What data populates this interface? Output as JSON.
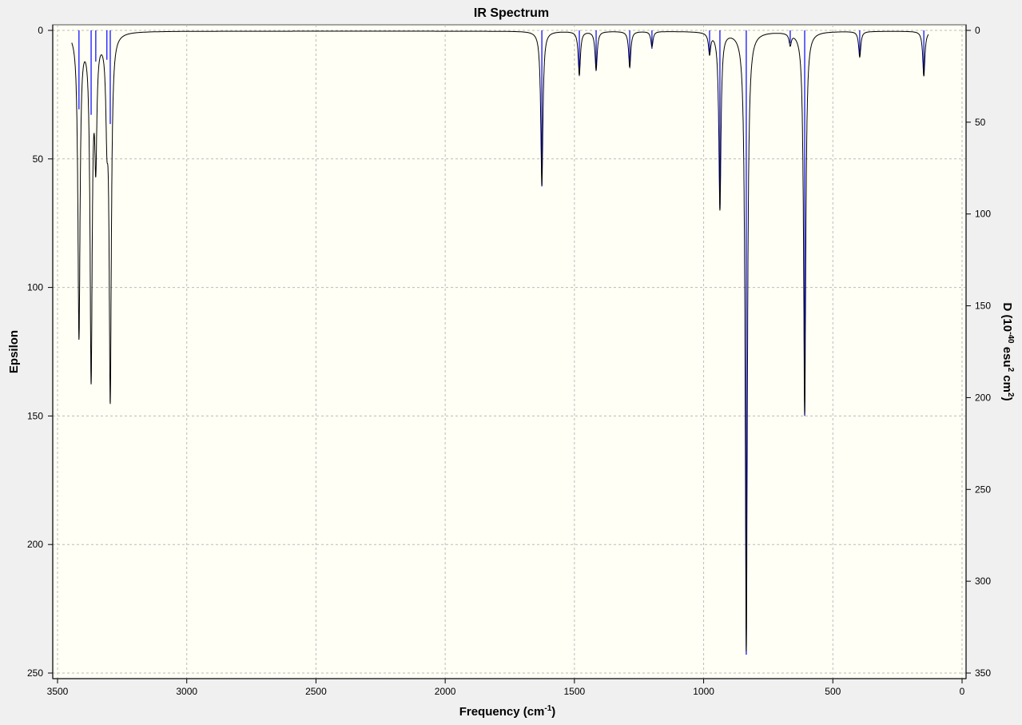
{
  "chart_data": {
    "type": "line",
    "title": "IR Spectrum",
    "xlabel": "Frequency (cm-1)",
    "xlabel_parts": {
      "main": "Frequency (cm",
      "sup": "-1",
      "close": ")"
    },
    "ylabel": "Epsilon",
    "y2label": "D (10-40 esu2 cm2)",
    "y2label_parts": {
      "a": "D (10",
      "s1": "-40",
      "b": " esu",
      "s2": "2",
      "c": " cm",
      "s3": "2",
      "d": ")"
    },
    "xlim": [
      3500,
      0
    ],
    "ylim": [
      0,
      250
    ],
    "y2lim": [
      0,
      350
    ],
    "x_ticks": [
      "3500",
      "3000",
      "2500",
      "2000",
      "1500",
      "1000",
      "500",
      "0"
    ],
    "y_ticks": [
      "0",
      "50",
      "100",
      "150",
      "200",
      "250"
    ],
    "y2_ticks": [
      "0",
      "50",
      "100",
      "150",
      "200",
      "250",
      "300",
      "350"
    ],
    "grid": true,
    "curve_color": "#000000",
    "stick_color": "#0000ff",
    "spectrum_range": [
      3445,
      130
    ],
    "peaks": [
      {
        "freq": 3417,
        "epsilon": 118,
        "D": 43
      },
      {
        "freq": 3370,
        "epsilon": 132,
        "D": 46
      },
      {
        "freq": 3352,
        "epsilon": 45,
        "D": 17
      },
      {
        "freq": 3309,
        "epsilon": 30,
        "D": 16
      },
      {
        "freq": 3296,
        "epsilon": 140,
        "D": 51
      },
      {
        "freq": 1626,
        "epsilon": 60,
        "D": 85
      },
      {
        "freq": 1481,
        "epsilon": 17,
        "D": 24
      },
      {
        "freq": 1416,
        "epsilon": 15,
        "D": 22
      },
      {
        "freq": 1286,
        "epsilon": 14,
        "D": 20
      },
      {
        "freq": 1200,
        "epsilon": 6,
        "D": 10
      },
      {
        "freq": 977,
        "epsilon": 8,
        "D": 12
      },
      {
        "freq": 937,
        "epsilon": 69,
        "D": 97
      },
      {
        "freq": 835,
        "epsilon": 241,
        "D": 340
      },
      {
        "freq": 665,
        "epsilon": 4.5,
        "D": 7
      },
      {
        "freq": 609,
        "epsilon": 149,
        "D": 210
      },
      {
        "freq": 396,
        "epsilon": 10,
        "D": 14
      },
      {
        "freq": 148,
        "epsilon": 17.5,
        "D": 24
      }
    ]
  }
}
